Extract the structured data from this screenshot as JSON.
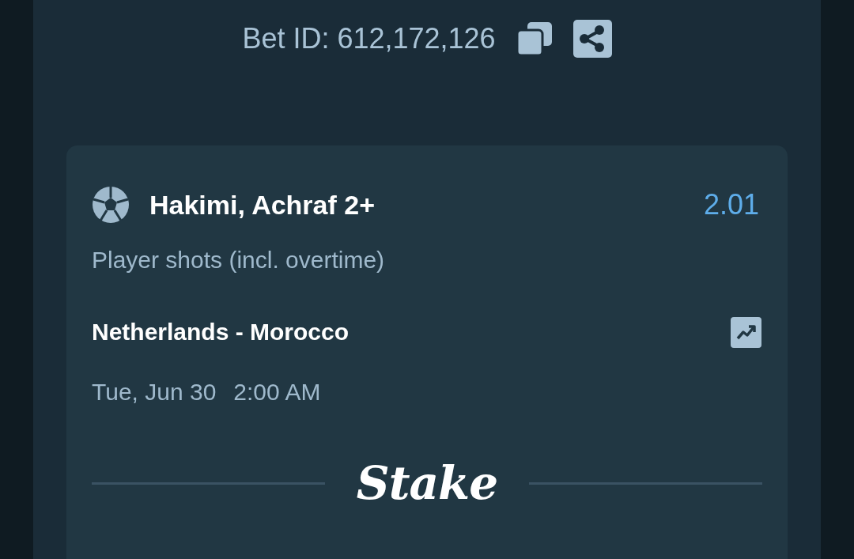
{
  "header": {
    "bet_id": "Bet ID: 612,172,126"
  },
  "selection": {
    "name": "Hakimi, Achraf 2+",
    "odds": "2.01",
    "market": "Player shots (incl. overtime)",
    "event": "Netherlands - Morocco",
    "date": "Tue, Jun 30",
    "time": "2:00 AM"
  },
  "footer": {
    "logo": "Stake"
  }
}
